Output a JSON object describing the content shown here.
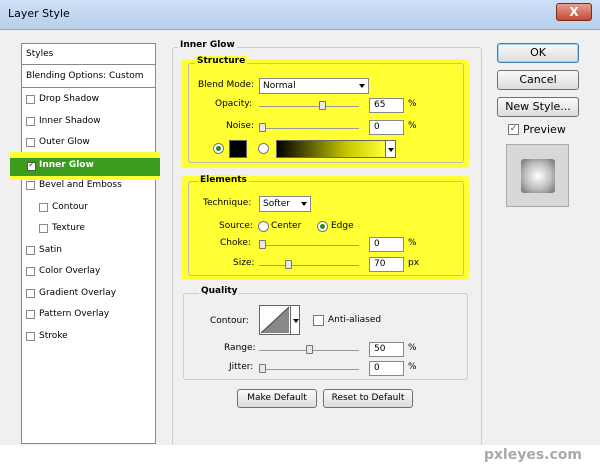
{
  "window": {
    "title": "Layer Style",
    "close_glyph": "X"
  },
  "sidebar": {
    "header": "Styles",
    "blending": "Blending Options: Custom",
    "items": [
      {
        "label": "Drop Shadow"
      },
      {
        "label": "Inner Shadow"
      },
      {
        "label": "Outer Glow"
      },
      {
        "label": "Inner Glow"
      },
      {
        "label": "Bevel and Emboss"
      },
      {
        "label": "Contour"
      },
      {
        "label": "Texture"
      },
      {
        "label": "Satin"
      },
      {
        "label": "Color Overlay"
      },
      {
        "label": "Gradient Overlay"
      },
      {
        "label": "Pattern Overlay"
      },
      {
        "label": "Stroke"
      }
    ]
  },
  "panel": {
    "title": "Inner Glow",
    "structure": {
      "title": "Structure",
      "blend_mode_label": "Blend Mode:",
      "blend_mode_value": "Normal",
      "opacity_label": "Opacity:",
      "opacity_value": "65",
      "opacity_level": 65,
      "noise_label": "Noise:",
      "noise_value": "0",
      "noise_level": 0,
      "percent": "%"
    },
    "elements": {
      "title": "Elements",
      "technique_label": "Technique:",
      "technique_value": "Softer",
      "source_label": "Source:",
      "center_label": "Center",
      "edge_label": "Edge",
      "choke_label": "Choke:",
      "choke_value": "0",
      "choke_level": 0,
      "size_label": "Size:",
      "size_value": "70",
      "size_level": 28,
      "percent": "%",
      "px": "px"
    },
    "quality": {
      "title": "Quality",
      "contour_label": "Contour:",
      "anti_aliased_label": "Anti-aliased",
      "range_label": "Range:",
      "range_value": "50",
      "range_level": 50,
      "jitter_label": "Jitter:",
      "jitter_value": "0",
      "jitter_level": 0,
      "percent": "%"
    },
    "make_default": "Make Default",
    "reset_default": "Reset to Default"
  },
  "buttons": {
    "ok": "OK",
    "cancel": "Cancel",
    "new_style": "New Style..."
  },
  "preview_label": "Preview",
  "watermark": "pxleyes.com",
  "colors": {
    "highlight": "#ffff33",
    "selected": "#3b9c1e",
    "glow_color": "#000000"
  }
}
